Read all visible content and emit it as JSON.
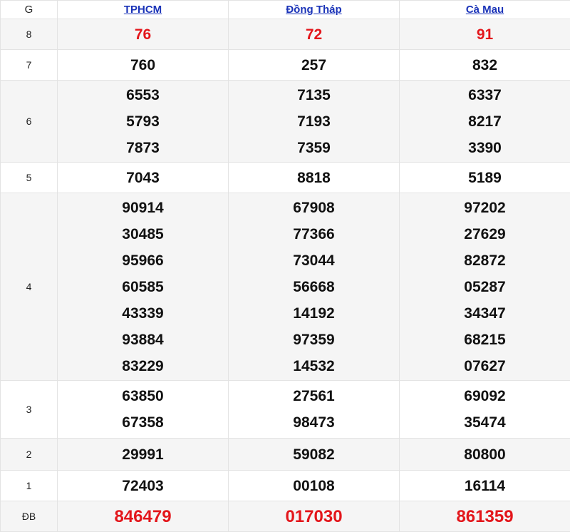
{
  "header": {
    "g_label": "G",
    "provinces": [
      "TPHCM",
      "Đồng Tháp",
      "Cà Mau"
    ]
  },
  "rows": [
    {
      "prize": "8",
      "values": [
        [
          "76"
        ],
        [
          "72"
        ],
        [
          "91"
        ]
      ],
      "style": "red"
    },
    {
      "prize": "7",
      "values": [
        [
          "760"
        ],
        [
          "257"
        ],
        [
          "832"
        ]
      ]
    },
    {
      "prize": "6",
      "values": [
        [
          "6553",
          "5793",
          "7873"
        ],
        [
          "7135",
          "7193",
          "7359"
        ],
        [
          "6337",
          "8217",
          "3390"
        ]
      ]
    },
    {
      "prize": "5",
      "values": [
        [
          "7043"
        ],
        [
          "8818"
        ],
        [
          "5189"
        ]
      ]
    },
    {
      "prize": "4",
      "values": [
        [
          "90914",
          "30485",
          "95966",
          "60585",
          "43339",
          "93884",
          "83229"
        ],
        [
          "67908",
          "77366",
          "73044",
          "56668",
          "14192",
          "97359",
          "14532"
        ],
        [
          "97202",
          "27629",
          "82872",
          "05287",
          "34347",
          "68215",
          "07627"
        ]
      ]
    },
    {
      "prize": "3",
      "values": [
        [
          "63850",
          "67358"
        ],
        [
          "27561",
          "98473"
        ],
        [
          "69092",
          "35474"
        ]
      ]
    },
    {
      "prize": "2",
      "values": [
        [
          "29991"
        ],
        [
          "59082"
        ],
        [
          "80800"
        ]
      ]
    },
    {
      "prize": "1",
      "values": [
        [
          "72403"
        ],
        [
          "00108"
        ],
        [
          "16114"
        ]
      ]
    },
    {
      "prize": "ĐB",
      "values": [
        [
          "846479"
        ],
        [
          "017030"
        ],
        [
          "861359"
        ]
      ],
      "style": "red-big"
    }
  ]
}
